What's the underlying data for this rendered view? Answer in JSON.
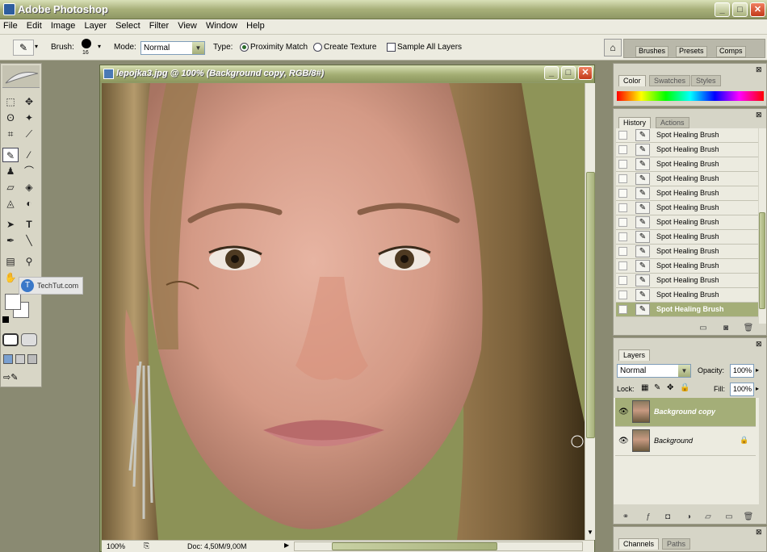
{
  "app": {
    "title": "Adobe Photoshop"
  },
  "window_buttons": {
    "minimize": "_",
    "maximize": "□",
    "close": "✕"
  },
  "menu": [
    "File",
    "Edit",
    "Image",
    "Layer",
    "Select",
    "Filter",
    "View",
    "Window",
    "Help"
  ],
  "options": {
    "brush_label": "Brush:",
    "brush_size": "16",
    "mode_label": "Mode:",
    "mode_value": "Normal",
    "type_label": "Type:",
    "type_options": [
      "Proximity Match",
      "Create Texture"
    ],
    "type_selected": "Proximity Match",
    "sample_all_layers": "Sample All Layers"
  },
  "palette_well": {
    "tabs": [
      "Brushes",
      "Presets",
      "Comps"
    ]
  },
  "toolbox": {
    "watermark": "TechTut.com"
  },
  "document": {
    "title": "lepojka3.jpg @ 100% (Background copy, RGB/8#)",
    "zoom": "100%",
    "doc_info": "Doc: 4,50M/9,00M"
  },
  "color_panel": {
    "tabs": [
      "Color",
      "Swatches",
      "Styles"
    ]
  },
  "history_panel": {
    "tabs": [
      "History",
      "Actions"
    ],
    "items": [
      "Spot Healing Brush",
      "Spot Healing Brush",
      "Spot Healing Brush",
      "Spot Healing Brush",
      "Spot Healing Brush",
      "Spot Healing Brush",
      "Spot Healing Brush",
      "Spot Healing Brush",
      "Spot Healing Brush",
      "Spot Healing Brush",
      "Spot Healing Brush",
      "Spot Healing Brush",
      "Spot Healing Brush"
    ]
  },
  "layers_panel": {
    "tab": "Layers",
    "blend_mode": "Normal",
    "opacity_label": "Opacity:",
    "opacity_value": "100%",
    "lock_label": "Lock:",
    "fill_label": "Fill:",
    "fill_value": "100%",
    "layers": [
      "Background copy",
      "Background"
    ]
  },
  "bottom_panel": {
    "tabs": [
      "Channels",
      "Paths"
    ]
  }
}
